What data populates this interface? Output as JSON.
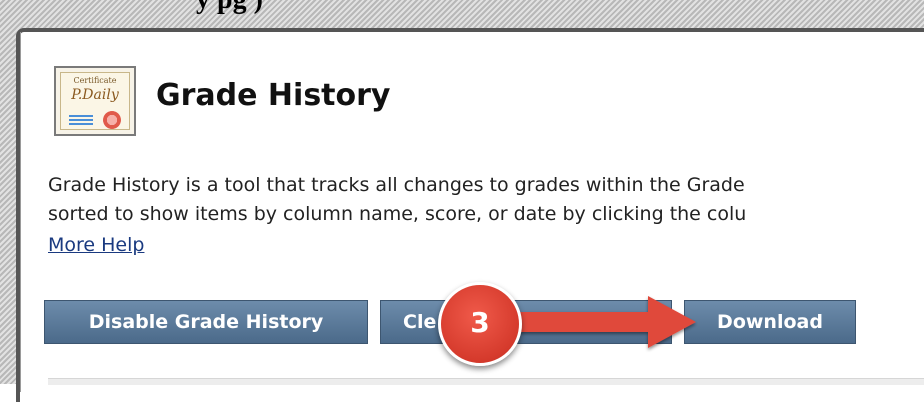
{
  "caption": {
    "text": "y pg )"
  },
  "header": {
    "title": "Grade History",
    "icon": "certificate-icon",
    "icon_label": "Certificate",
    "icon_script": "P.Daily"
  },
  "description": {
    "line1": "Grade History is a tool that tracks all changes to grades within the Grade",
    "line2": "sorted to show items by column name, score, or date by clicking the colu"
  },
  "help": {
    "link_label": "More Help"
  },
  "toolbar": {
    "disable_label": "Disable Grade History",
    "clear_label": "Cle         le Histor",
    "download_label": "Download"
  },
  "annotation": {
    "step_number": "3",
    "color": "#d53a2c",
    "arrow_color": "#e0483a"
  },
  "colors": {
    "button": "#5a7899",
    "link": "#1a3a80"
  }
}
